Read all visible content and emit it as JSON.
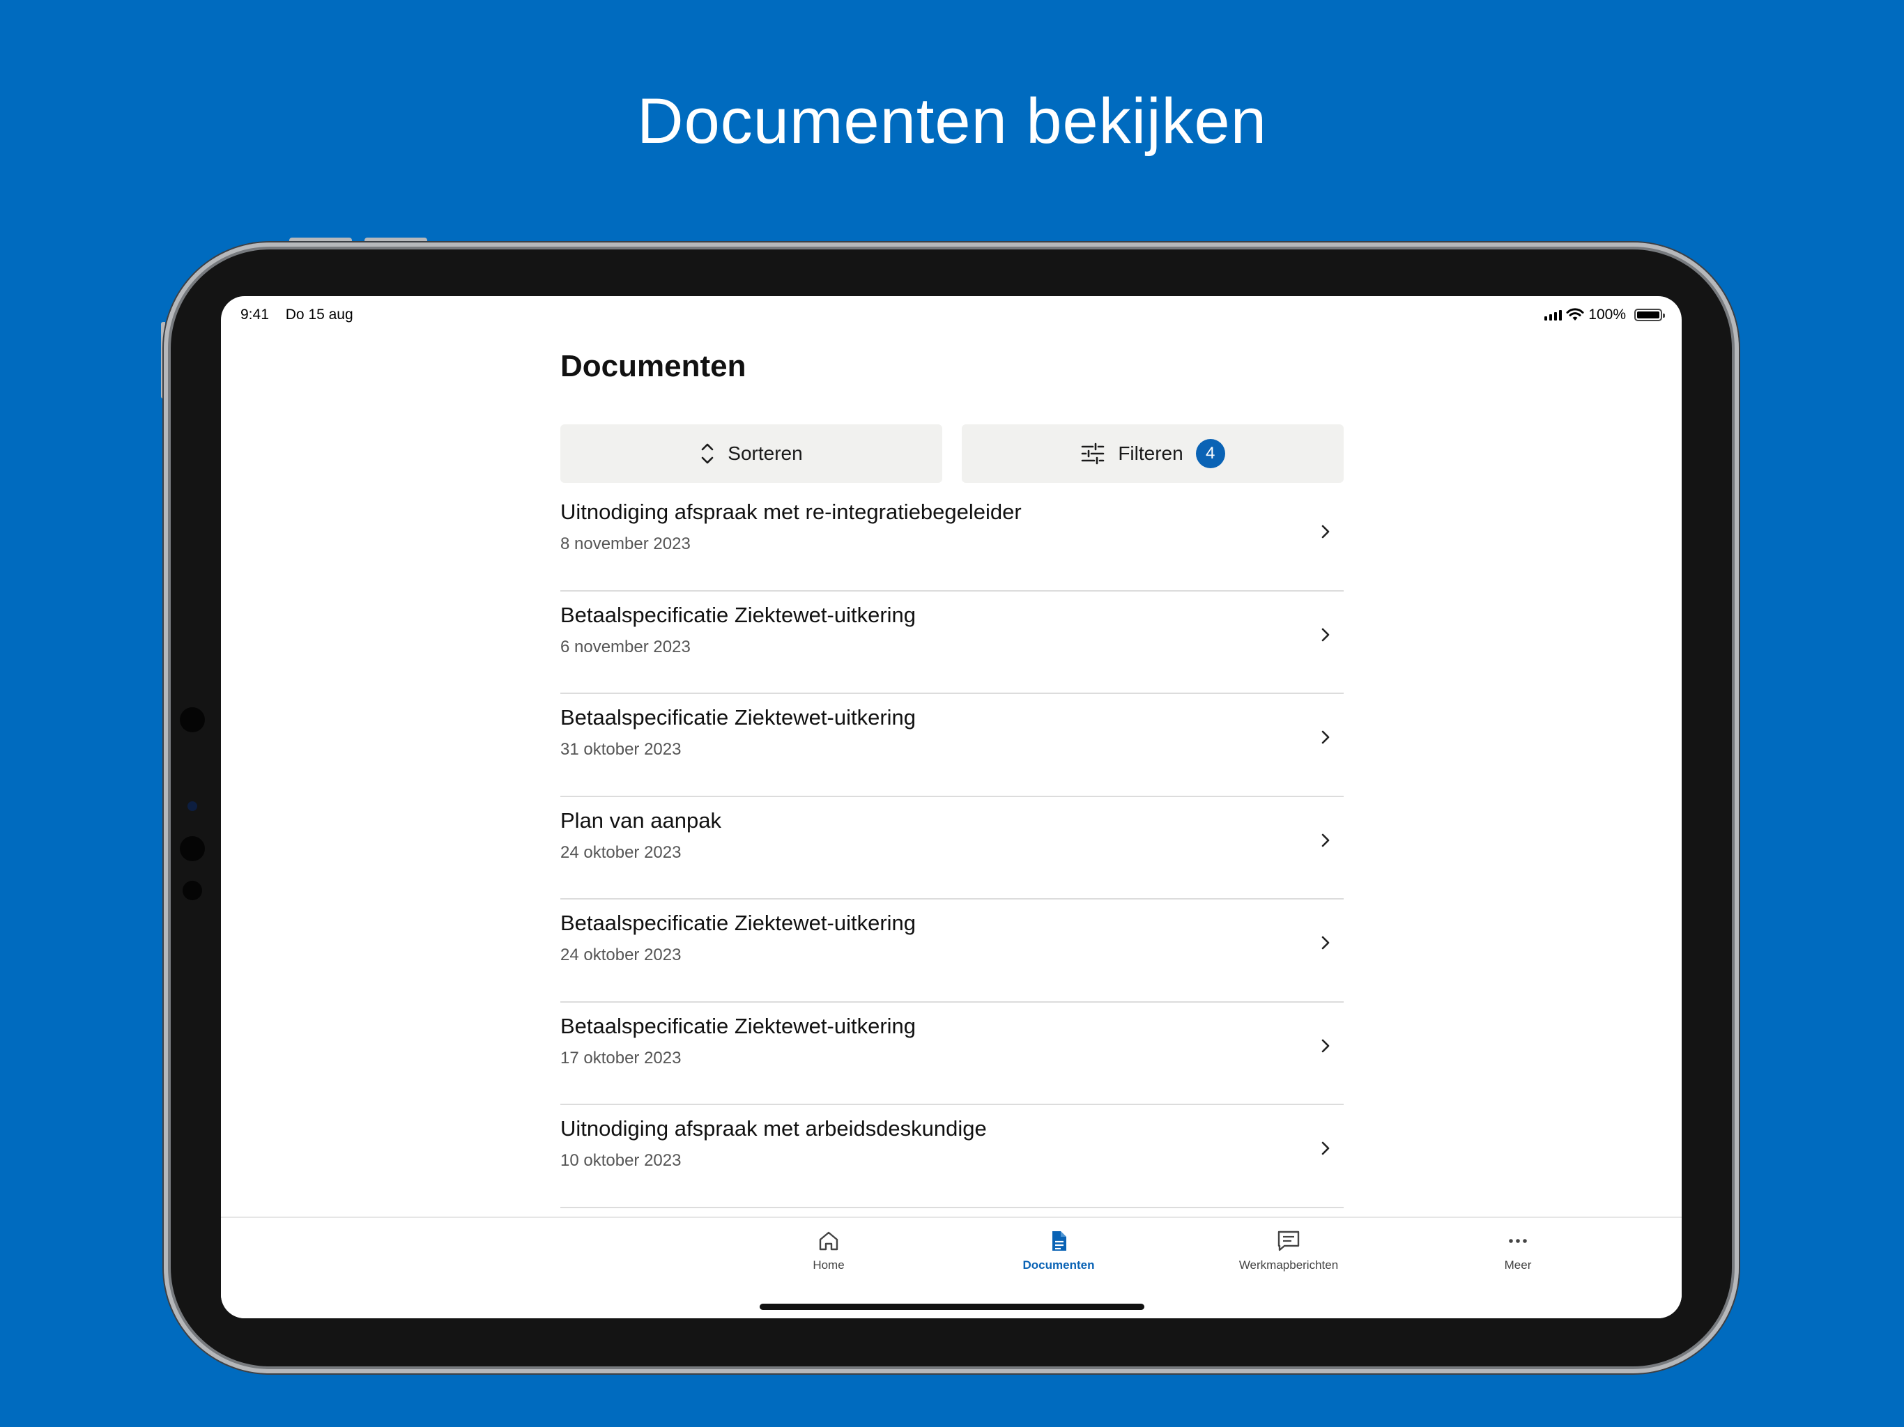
{
  "headline": "Documenten bekijken",
  "status_bar": {
    "time": "9:41",
    "date": "Do 15 aug",
    "battery": "100%"
  },
  "page": {
    "title": "Documenten",
    "sort_label": "Sorteren",
    "filter_label": "Filteren",
    "filter_count": "4"
  },
  "documents": [
    {
      "title": "Uitnodiging afspraak met re-integratiebegeleider",
      "date": "8 november 2023"
    },
    {
      "title": "Betaalspecificatie Ziektewet-uitkering",
      "date": "6 november 2023"
    },
    {
      "title": "Betaalspecificatie Ziektewet-uitkering",
      "date": "31 oktober 2023"
    },
    {
      "title": "Plan van aanpak",
      "date": "24 oktober 2023"
    },
    {
      "title": "Betaalspecificatie Ziektewet-uitkering",
      "date": "24 oktober 2023"
    },
    {
      "title": "Betaalspecificatie Ziektewet-uitkering",
      "date": "17 oktober 2023"
    },
    {
      "title": "Uitnodiging afspraak met arbeidsdeskundige",
      "date": "10 oktober 2023"
    }
  ],
  "tabs": [
    {
      "label": "Home",
      "icon": "home-icon",
      "active": false
    },
    {
      "label": "Documenten",
      "icon": "document-icon",
      "active": true
    },
    {
      "label": "Werkmapberichten",
      "icon": "message-icon",
      "active": false
    },
    {
      "label": "Meer",
      "icon": "more-icon",
      "active": false
    }
  ],
  "colors": {
    "background": "#006bbf",
    "accent": "#0a63b5"
  }
}
